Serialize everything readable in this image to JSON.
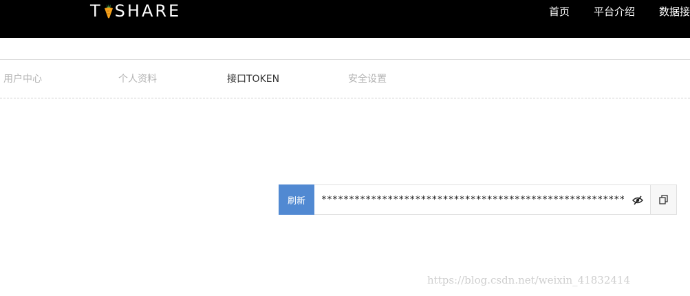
{
  "header": {
    "logo_left": "T",
    "logo_right": "SHARE",
    "nav": [
      {
        "label": "首页"
      },
      {
        "label": "平台介绍"
      },
      {
        "label": "数据接"
      }
    ]
  },
  "tabs": [
    {
      "label": "用户中心",
      "active": false
    },
    {
      "label": "个人资料",
      "active": false
    },
    {
      "label": "接口TOKEN",
      "active": true
    },
    {
      "label": "安全设置",
      "active": false
    }
  ],
  "token": {
    "refresh_label": "刷新",
    "masked_value": "************************************************************",
    "show_icon": "eye-slash-icon",
    "copy_icon": "copy-icon"
  },
  "colors": {
    "header_bg": "#000000",
    "accent": "#5189d2",
    "logo_carrot": "#f7a21b"
  },
  "watermark": "https://blog.csdn.net/weixin_41832414"
}
